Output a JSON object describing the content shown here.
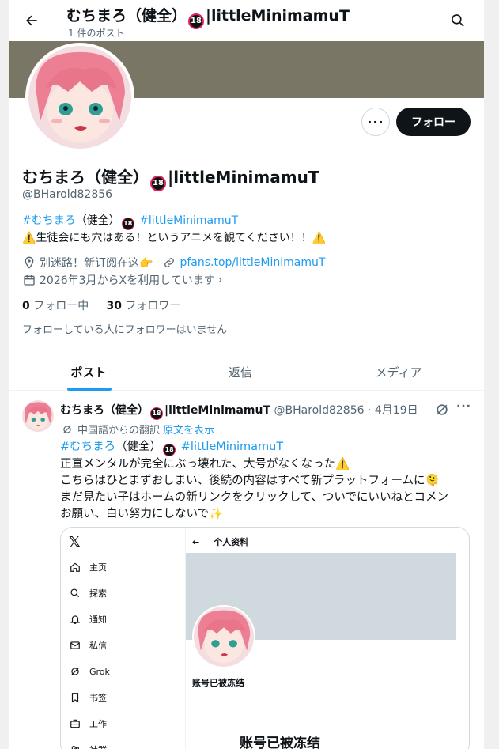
{
  "header": {
    "title": "むちまろ（健全）🔞|littleMinimamuT",
    "title_name": "むちまろ（健全）",
    "title_suffix": "|littleMinimamuT",
    "post_count": "1 件のポスト"
  },
  "profile": {
    "name": "むちまろ（健全）",
    "name_suffix": "|littleMinimamuT",
    "handle": "@BHarold82856",
    "bio_line1_tag1": "#むちまろ",
    "bio_line1_mid": "（健全）",
    "bio_line1_tag2": "#littleMinimamuT",
    "bio_line2": "⚠️生徒会にも穴はある！というアニメを観てください！！⚠️",
    "location": "别迷路！新订阅在这👉",
    "link": "pfans.top/littleMinimamuT",
    "joined": "2026年3月からXを利用しています",
    "following_count": "0",
    "following_label": "フォロー中",
    "followers_count": "30",
    "followers_label": "フォロワー",
    "no_followers_note": "フォローしている人にフォロワーはいません",
    "follow_button": "フォロー",
    "more_button": "···",
    "badge": "18"
  },
  "tabs": [
    {
      "label": "ポスト",
      "active": true
    },
    {
      "label": "返信",
      "active": false
    },
    {
      "label": "メディア",
      "active": false
    }
  ],
  "post": {
    "author": "むちまろ（健全）",
    "author_suffix": "|littleMinimamuT",
    "handle": "@BHarold82856",
    "date": "· 4月19日",
    "translated_from": "中国語からの翻訳",
    "show_original": "原文を表示",
    "tag1": "#むちまろ",
    "tag_mid": "（健全）",
    "tag2": "#littleMinimamuT",
    "line1": "正直メンタルが完全にぶっ壊れた、大号がなくなった⚠️",
    "line2": "こちらはひとまずおしまい、後続の内容はすべて新プラットフォームに🫠",
    "line3": "まだ見たい子はホームの新リンクをクリックして、ついでにいいねとコメン",
    "line4": "お願い、白い努力にしないで✨",
    "more": "···"
  },
  "card": {
    "logo": "𝕏",
    "nav": [
      {
        "label": "主页",
        "icon": "home-icon"
      },
      {
        "label": "探索",
        "icon": "search-icon"
      },
      {
        "label": "通知",
        "icon": "bell-icon"
      },
      {
        "label": "私信",
        "icon": "mail-icon"
      },
      {
        "label": "Grok",
        "icon": "grok-icon"
      },
      {
        "label": "书签",
        "icon": "bookmark-icon"
      },
      {
        "label": "工作",
        "icon": "briefcase-icon"
      },
      {
        "label": "社群",
        "icon": "people-icon"
      }
    ],
    "back_title": "个人资料",
    "frozen_small": "账号已被冻结",
    "frozen_big": "账号已被冻结"
  }
}
